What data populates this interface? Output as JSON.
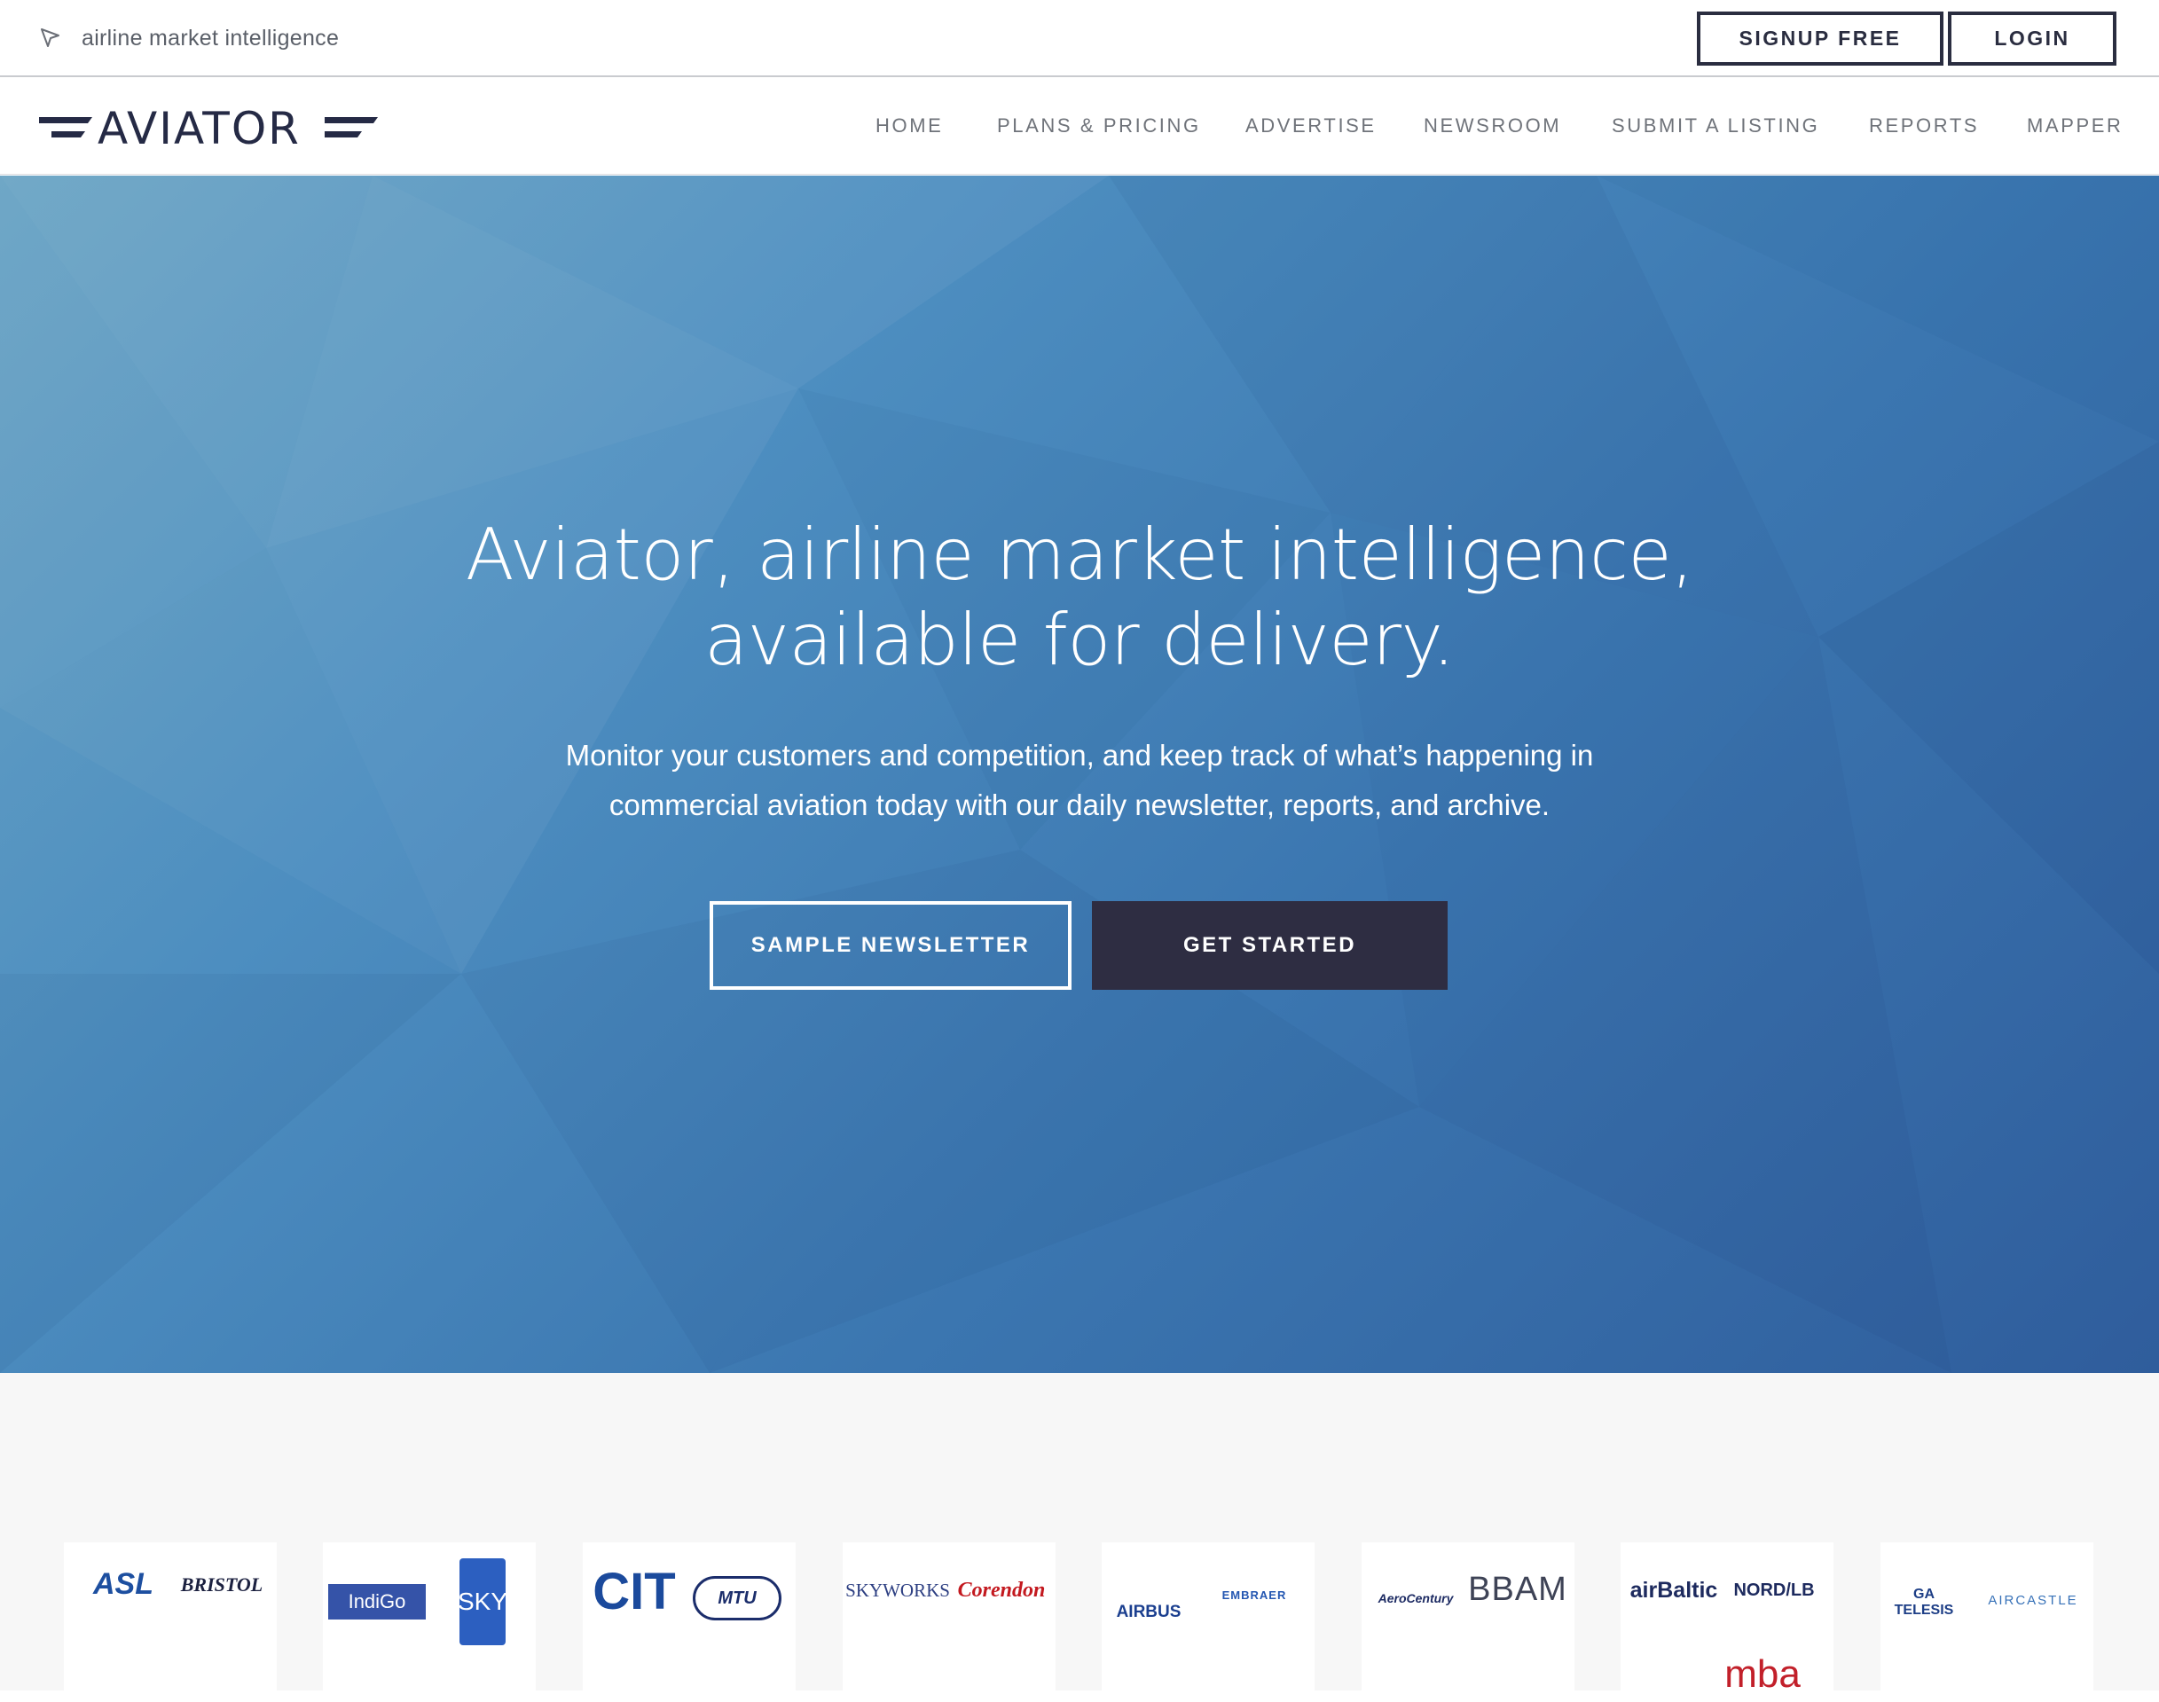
{
  "topbar": {
    "tagline": "airline market intelligence",
    "signup_label": "SIGNUP FREE",
    "login_label": "LOGIN"
  },
  "brand": {
    "name": "AVIATOR",
    "color": "#252a45"
  },
  "nav": {
    "items": [
      "HOME",
      "PLANS & PRICING",
      "ADVERTISE",
      "NEWSROOM",
      "SUBMIT A LISTING",
      "REPORTS",
      "MAPPER"
    ]
  },
  "hero": {
    "title_line1": "Aviator, airline market intelligence,",
    "title_line2": "available for delivery.",
    "subtitle_line1": "Monitor your customers and competition, and keep track of what’s happening in",
    "subtitle_line2": "commercial aviation today with our daily newsletter, reports, and archive.",
    "sample_button": "SAMPLE NEWSLETTER",
    "start_button": "GET STARTED"
  },
  "client_logos": [
    [
      "ASL",
      "BRISTOL"
    ],
    [
      "IndiGo",
      "SKY"
    ],
    [
      "CIT",
      "MTU"
    ],
    [
      "SKYWORKS",
      "Corendon"
    ],
    [
      "AIRBUS",
      "EMBRAER"
    ],
    [
      "AeroCentury",
      "BBAM"
    ],
    [
      "airBaltic",
      "NORD/LB",
      "mba"
    ],
    [
      "GA TELESIS",
      "AIRCASTLE"
    ]
  ],
  "colors": {
    "accent_dark": "#2e2d42",
    "hero_light": "#6aa4c4",
    "hero_dark": "#2f5d9c",
    "nav_text": "#6f737a"
  }
}
